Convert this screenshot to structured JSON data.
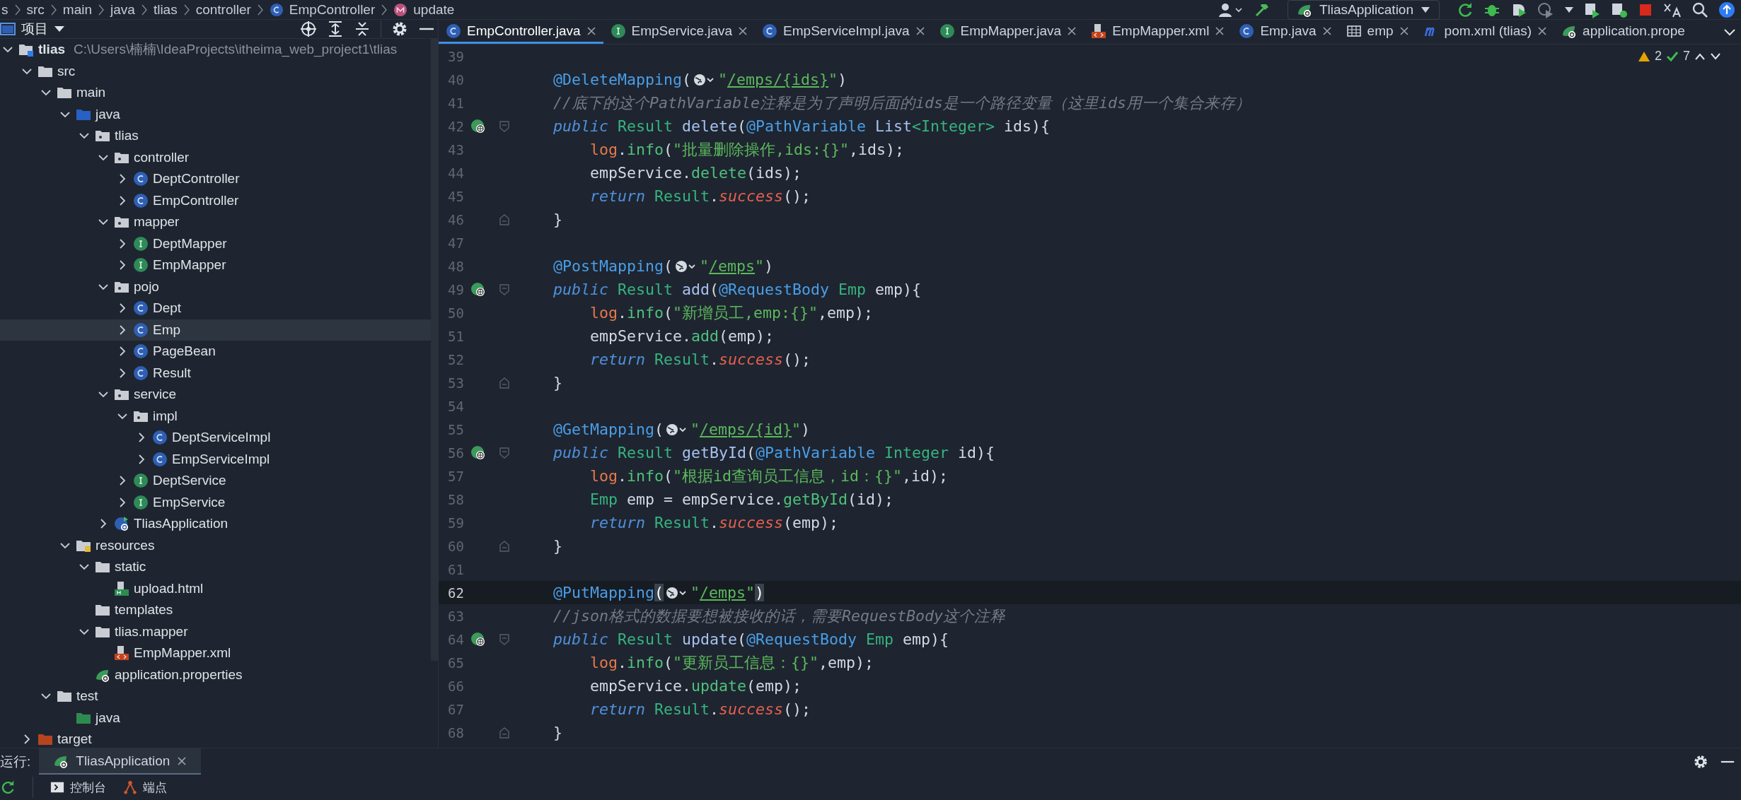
{
  "breadcrumb": [
    {
      "label": "s"
    },
    {
      "label": "src"
    },
    {
      "label": "main"
    },
    {
      "label": "java"
    },
    {
      "label": "tlias"
    },
    {
      "label": "controller"
    },
    {
      "label": "EmpController",
      "kind": "class"
    },
    {
      "label": "update",
      "kind": "method"
    }
  ],
  "run_config": {
    "label": "TliasApplication"
  },
  "project_panel": {
    "title": "项目",
    "tree": [
      {
        "label": "tlias",
        "path": "C:\\Users\\楠楠\\IdeaProjects\\itheima_web_project1\\tlias",
        "kind": "module",
        "expanded": true,
        "selected": false,
        "children": [
          {
            "label": "src",
            "kind": "folder",
            "expanded": true,
            "selected": false,
            "children": [
              {
                "label": "main",
                "kind": "folder",
                "expanded": true,
                "selected": false,
                "children": [
                  {
                    "label": "java",
                    "kind": "source",
                    "expanded": true,
                    "selected": false,
                    "children": [
                      {
                        "label": "tlias",
                        "kind": "package",
                        "expanded": true,
                        "selected": false,
                        "children": [
                          {
                            "label": "controller",
                            "kind": "package",
                            "expanded": true,
                            "selected": false,
                            "children": [
                              {
                                "label": "DeptController",
                                "kind": "class",
                                "expanded": false,
                                "selected": false
                              },
                              {
                                "label": "EmpController",
                                "kind": "class",
                                "expanded": false,
                                "selected": false
                              }
                            ]
                          },
                          {
                            "label": "mapper",
                            "kind": "package",
                            "expanded": true,
                            "selected": false,
                            "children": [
                              {
                                "label": "DeptMapper",
                                "kind": "interface",
                                "expanded": false,
                                "selected": false
                              },
                              {
                                "label": "EmpMapper",
                                "kind": "interface",
                                "expanded": false,
                                "selected": false
                              }
                            ]
                          },
                          {
                            "label": "pojo",
                            "kind": "package",
                            "expanded": true,
                            "selected": false,
                            "children": [
                              {
                                "label": "Dept",
                                "kind": "class",
                                "expanded": false,
                                "selected": false
                              },
                              {
                                "label": "Emp",
                                "kind": "class",
                                "expanded": false,
                                "selected": true
                              },
                              {
                                "label": "PageBean",
                                "kind": "class",
                                "expanded": false,
                                "selected": false
                              },
                              {
                                "label": "Result",
                                "kind": "class",
                                "expanded": false,
                                "selected": false
                              }
                            ]
                          },
                          {
                            "label": "service",
                            "kind": "package",
                            "expanded": true,
                            "selected": false,
                            "children": [
                              {
                                "label": "impl",
                                "kind": "package",
                                "expanded": true,
                                "selected": false,
                                "children": [
                                  {
                                    "label": "DeptServiceImpl",
                                    "kind": "class",
                                    "expanded": false,
                                    "selected": false
                                  },
                                  {
                                    "label": "EmpServiceImpl",
                                    "kind": "class",
                                    "expanded": false,
                                    "selected": false
                                  }
                                ]
                              },
                              {
                                "label": "DeptService",
                                "kind": "interface",
                                "expanded": false,
                                "selected": false
                              },
                              {
                                "label": "EmpService",
                                "kind": "interface",
                                "expanded": false,
                                "selected": false
                              }
                            ]
                          },
                          {
                            "label": "TliasApplication",
                            "kind": "application",
                            "expanded": false,
                            "selected": false
                          }
                        ]
                      }
                    ]
                  },
                  {
                    "label": "resources",
                    "kind": "resources",
                    "expanded": true,
                    "selected": false,
                    "children": [
                      {
                        "label": "static",
                        "kind": "folder",
                        "expanded": true,
                        "selected": false,
                        "children": [
                          {
                            "label": "upload.html",
                            "kind": "html",
                            "selected": false
                          }
                        ]
                      },
                      {
                        "label": "templates",
                        "kind": "folder",
                        "selected": false
                      },
                      {
                        "label": "tlias.mapper",
                        "kind": "folder",
                        "expanded": true,
                        "selected": false,
                        "children": [
                          {
                            "label": "EmpMapper.xml",
                            "kind": "xml",
                            "selected": false
                          }
                        ]
                      },
                      {
                        "label": "application.properties",
                        "kind": "properties",
                        "selected": false
                      }
                    ]
                  }
                ]
              },
              {
                "label": "test",
                "kind": "folder",
                "expanded": true,
                "selected": false,
                "children": [
                  {
                    "label": "java",
                    "kind": "test",
                    "selected": false
                  }
                ]
              }
            ]
          },
          {
            "label": "target",
            "kind": "excluded",
            "expanded": false,
            "selected": false
          }
        ]
      }
    ]
  },
  "editor": {
    "tabs": [
      {
        "label": "EmpController.java",
        "kind": "class",
        "selected": true,
        "closable": true
      },
      {
        "label": "EmpService.java",
        "kind": "interface",
        "selected": false,
        "closable": true
      },
      {
        "label": "EmpServiceImpl.java",
        "kind": "class",
        "selected": false,
        "closable": true
      },
      {
        "label": "EmpMapper.java",
        "kind": "interface",
        "selected": false,
        "closable": true
      },
      {
        "label": "EmpMapper.xml",
        "kind": "xml",
        "selected": false,
        "closable": true
      },
      {
        "label": "Emp.java",
        "kind": "class",
        "selected": false,
        "closable": true
      },
      {
        "label": "emp",
        "kind": "table",
        "selected": false,
        "closable": true
      },
      {
        "label": "pom.xml (tlias)",
        "kind": "maven",
        "selected": false,
        "closable": true
      },
      {
        "label": "application.prope",
        "kind": "properties",
        "selected": false,
        "closable": false
      }
    ],
    "inspections": {
      "warnings": "2",
      "passed": "7"
    },
    "lines": [
      {
        "number": "39",
        "current": false
      },
      {
        "number": "40",
        "current": false,
        "tokens": [
          {
            "kind": "ann",
            "text": "    @DeleteMapping"
          },
          {
            "kind": "plain",
            "text": "("
          },
          {
            "kind": "globe"
          },
          {
            "kind": "str",
            "text": "\""
          },
          {
            "kind": "url",
            "text": "/emps/{ids}"
          },
          {
            "kind": "str",
            "text": "\""
          },
          {
            "kind": "plain",
            "text": ")"
          }
        ]
      },
      {
        "number": "41",
        "current": false,
        "tokens": [
          {
            "kind": "cmt",
            "text": "    //底下的这个PathVariable注释是为了声明后面的ids是一个路径变量（这里ids用一个集合来存）"
          }
        ]
      },
      {
        "number": "42",
        "current": false,
        "endpoint": true,
        "fold_start": true,
        "tokens": [
          {
            "kind": "kw",
            "text": "    public "
          },
          {
            "kind": "type",
            "text": "Result "
          },
          {
            "kind": "decl",
            "text": "delete"
          },
          {
            "kind": "plain",
            "text": "("
          },
          {
            "kind": "ann",
            "text": "@PathVariable "
          },
          {
            "kind": "decl",
            "text": "List"
          },
          {
            "kind": "type",
            "text": "<Integer>"
          },
          {
            "kind": "plain",
            "text": " ids){"
          }
        ]
      },
      {
        "number": "43",
        "current": false,
        "tokens": [
          {
            "kind": "field",
            "text": "        log"
          },
          {
            "kind": "plain",
            "text": "."
          },
          {
            "kind": "call",
            "text": "info"
          },
          {
            "kind": "plain",
            "text": "("
          },
          {
            "kind": "str",
            "text": "\"批量删除操作,ids:{}\""
          },
          {
            "kind": "plain",
            "text": ",ids);"
          }
        ]
      },
      {
        "number": "44",
        "current": false,
        "tokens": [
          {
            "kind": "plain",
            "text": "        empService."
          },
          {
            "kind": "call",
            "text": "delete"
          },
          {
            "kind": "plain",
            "text": "(ids);"
          }
        ]
      },
      {
        "number": "45",
        "current": false,
        "tokens": [
          {
            "kind": "kw",
            "text": "        return "
          },
          {
            "kind": "type",
            "text": "Result"
          },
          {
            "kind": "plain",
            "text": "."
          },
          {
            "kind": "static",
            "text": "success"
          },
          {
            "kind": "plain",
            "text": "();"
          }
        ]
      },
      {
        "number": "46",
        "current": false,
        "fold_end": true,
        "tokens": [
          {
            "kind": "plain",
            "text": "    }"
          }
        ]
      },
      {
        "number": "47",
        "current": false
      },
      {
        "number": "48",
        "current": false,
        "tokens": [
          {
            "kind": "ann",
            "text": "    @PostMapping"
          },
          {
            "kind": "plain",
            "text": "("
          },
          {
            "kind": "globe"
          },
          {
            "kind": "str",
            "text": "\""
          },
          {
            "kind": "url",
            "text": "/emps"
          },
          {
            "kind": "str",
            "text": "\""
          },
          {
            "kind": "plain",
            "text": ")"
          }
        ]
      },
      {
        "number": "49",
        "current": false,
        "endpoint": true,
        "fold_start": true,
        "tokens": [
          {
            "kind": "kw",
            "text": "    public "
          },
          {
            "kind": "type",
            "text": "Result "
          },
          {
            "kind": "decl",
            "text": "add"
          },
          {
            "kind": "plain",
            "text": "("
          },
          {
            "kind": "ann",
            "text": "@RequestBody "
          },
          {
            "kind": "type",
            "text": "Emp"
          },
          {
            "kind": "plain",
            "text": " emp){"
          }
        ]
      },
      {
        "number": "50",
        "current": false,
        "tokens": [
          {
            "kind": "field",
            "text": "        log"
          },
          {
            "kind": "plain",
            "text": "."
          },
          {
            "kind": "call",
            "text": "info"
          },
          {
            "kind": "plain",
            "text": "("
          },
          {
            "kind": "str",
            "text": "\"新增员工,emp:{}\""
          },
          {
            "kind": "plain",
            "text": ",emp);"
          }
        ]
      },
      {
        "number": "51",
        "current": false,
        "tokens": [
          {
            "kind": "plain",
            "text": "        empService."
          },
          {
            "kind": "call",
            "text": "add"
          },
          {
            "kind": "plain",
            "text": "(emp);"
          }
        ]
      },
      {
        "number": "52",
        "current": false,
        "tokens": [
          {
            "kind": "kw",
            "text": "        return "
          },
          {
            "kind": "type",
            "text": "Result"
          },
          {
            "kind": "plain",
            "text": "."
          },
          {
            "kind": "static",
            "text": "success"
          },
          {
            "kind": "plain",
            "text": "();"
          }
        ]
      },
      {
        "number": "53",
        "current": false,
        "fold_end": true,
        "tokens": [
          {
            "kind": "plain",
            "text": "    }"
          }
        ]
      },
      {
        "number": "54",
        "current": false
      },
      {
        "number": "55",
        "current": false,
        "tokens": [
          {
            "kind": "ann",
            "text": "    @GetMapping"
          },
          {
            "kind": "plain",
            "text": "("
          },
          {
            "kind": "globe"
          },
          {
            "kind": "str",
            "text": "\""
          },
          {
            "kind": "url",
            "text": "/emps/{id}"
          },
          {
            "kind": "str",
            "text": "\""
          },
          {
            "kind": "plain",
            "text": ")"
          }
        ]
      },
      {
        "number": "56",
        "current": false,
        "endpoint": true,
        "fold_start": true,
        "tokens": [
          {
            "kind": "kw",
            "text": "    public "
          },
          {
            "kind": "type",
            "text": "Result "
          },
          {
            "kind": "decl",
            "text": "getById"
          },
          {
            "kind": "plain",
            "text": "("
          },
          {
            "kind": "ann",
            "text": "@PathVariable "
          },
          {
            "kind": "type",
            "text": "Integer"
          },
          {
            "kind": "plain",
            "text": " id){"
          }
        ]
      },
      {
        "number": "57",
        "current": false,
        "tokens": [
          {
            "kind": "field",
            "text": "        log"
          },
          {
            "kind": "plain",
            "text": "."
          },
          {
            "kind": "call",
            "text": "info"
          },
          {
            "kind": "plain",
            "text": "("
          },
          {
            "kind": "str",
            "text": "\"根据id查询员工信息，id：{}\""
          },
          {
            "kind": "plain",
            "text": ",id);"
          }
        ]
      },
      {
        "number": "58",
        "current": false,
        "tokens": [
          {
            "kind": "type",
            "text": "        Emp"
          },
          {
            "kind": "plain",
            "text": " emp = empService."
          },
          {
            "kind": "call",
            "text": "getById"
          },
          {
            "kind": "plain",
            "text": "(id);"
          }
        ]
      },
      {
        "number": "59",
        "current": false,
        "tokens": [
          {
            "kind": "kw",
            "text": "        return "
          },
          {
            "kind": "type",
            "text": "Result"
          },
          {
            "kind": "plain",
            "text": "."
          },
          {
            "kind": "static",
            "text": "success"
          },
          {
            "kind": "plain",
            "text": "(emp);"
          }
        ]
      },
      {
        "number": "60",
        "current": false,
        "fold_end": true,
        "tokens": [
          {
            "kind": "plain",
            "text": "    }"
          }
        ]
      },
      {
        "number": "61",
        "current": false
      },
      {
        "number": "62",
        "current": true,
        "tokens": [
          {
            "kind": "ann",
            "text": "    @PutMapping"
          },
          {
            "kind": "match",
            "text": "("
          },
          {
            "kind": "globe"
          },
          {
            "kind": "str",
            "text": "\""
          },
          {
            "kind": "url",
            "text": "/emps"
          },
          {
            "kind": "str",
            "text": "\""
          },
          {
            "kind": "match",
            "text": ")"
          }
        ]
      },
      {
        "number": "63",
        "current": false,
        "tokens": [
          {
            "kind": "cmt",
            "text": "    //json格式的数据要想被接收的话，需要RequestBody这个注释"
          }
        ]
      },
      {
        "number": "64",
        "current": false,
        "endpoint": true,
        "fold_start": true,
        "tokens": [
          {
            "kind": "kw",
            "text": "    public "
          },
          {
            "kind": "type",
            "text": "Result "
          },
          {
            "kind": "decl",
            "text": "update"
          },
          {
            "kind": "plain",
            "text": "("
          },
          {
            "kind": "ann",
            "text": "@RequestBody "
          },
          {
            "kind": "type",
            "text": "Emp"
          },
          {
            "kind": "plain",
            "text": " emp){"
          }
        ]
      },
      {
        "number": "65",
        "current": false,
        "tokens": [
          {
            "kind": "field",
            "text": "        log"
          },
          {
            "kind": "plain",
            "text": "."
          },
          {
            "kind": "call",
            "text": "info"
          },
          {
            "kind": "plain",
            "text": "("
          },
          {
            "kind": "str",
            "text": "\"更新员工信息：{}\""
          },
          {
            "kind": "plain",
            "text": ",emp);"
          }
        ]
      },
      {
        "number": "66",
        "current": false,
        "tokens": [
          {
            "kind": "plain",
            "text": "        empService."
          },
          {
            "kind": "call",
            "text": "update"
          },
          {
            "kind": "plain",
            "text": "(emp);"
          }
        ]
      },
      {
        "number": "67",
        "current": false,
        "tokens": [
          {
            "kind": "kw",
            "text": "        return "
          },
          {
            "kind": "type",
            "text": "Result"
          },
          {
            "kind": "plain",
            "text": "."
          },
          {
            "kind": "static",
            "text": "success"
          },
          {
            "kind": "plain",
            "text": "();"
          }
        ]
      },
      {
        "number": "68",
        "current": false,
        "fold_end": true,
        "tokens": [
          {
            "kind": "plain",
            "text": "    }"
          }
        ]
      }
    ]
  },
  "run_panel": {
    "label": "运行:",
    "tabs": [
      {
        "label": "TliasApplication",
        "selected": true
      }
    ],
    "views": [
      {
        "label": "控制台",
        "kind": "console"
      },
      {
        "label": "端点",
        "kind": "endpoints"
      }
    ]
  }
}
